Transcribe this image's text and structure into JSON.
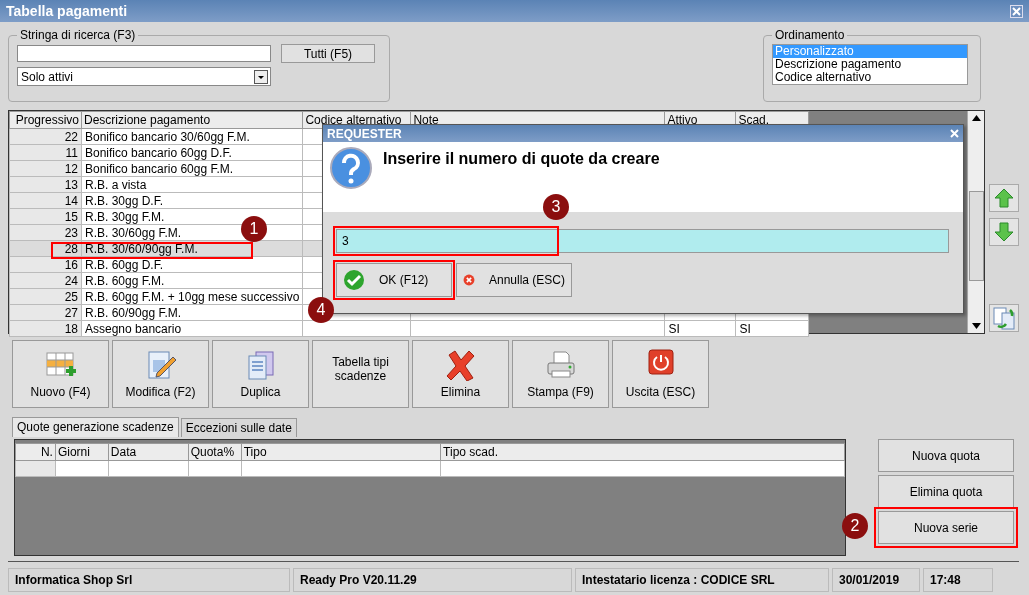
{
  "window": {
    "title": "Tabella pagamenti"
  },
  "search": {
    "legend": "Stringa di ricerca (F3)",
    "all_button": "Tutti (F5)",
    "filter": "Solo attivi"
  },
  "ordering": {
    "legend": "Ordinamento",
    "options": [
      {
        "label": "Personalizzato",
        "selected": true
      },
      {
        "label": "Descrizione pagamento",
        "selected": false
      },
      {
        "label": "Codice alternativo",
        "selected": false
      }
    ]
  },
  "table": {
    "columns": [
      "Progressivo",
      "Descrizione pagamento",
      "Codice alternativo",
      "Note",
      "Attivo",
      "Scad."
    ],
    "rows": [
      {
        "progressivo": "22",
        "descrizione": "Bonifico bancario 30/60gg F.M.",
        "selected": false
      },
      {
        "progressivo": "11",
        "descrizione": "Bonifico bancario 60gg D.F.",
        "selected": false
      },
      {
        "progressivo": "12",
        "descrizione": "Bonifico bancario 60gg F.M.",
        "selected": false
      },
      {
        "progressivo": "13",
        "descrizione": "R.B. a vista",
        "selected": false
      },
      {
        "progressivo": "14",
        "descrizione": "R.B. 30gg D.F.",
        "selected": false
      },
      {
        "progressivo": "15",
        "descrizione": "R.B. 30gg F.M.",
        "selected": false
      },
      {
        "progressivo": "23",
        "descrizione": "R.B. 30/60gg F.M.",
        "selected": false
      },
      {
        "progressivo": "28",
        "descrizione": "R.B. 30/60/90gg F.M.",
        "selected": true,
        "callout": "1"
      },
      {
        "progressivo": "16",
        "descrizione": "R.B. 60gg D.F.",
        "selected": false
      },
      {
        "progressivo": "24",
        "descrizione": "R.B. 60gg F.M.",
        "selected": false
      },
      {
        "progressivo": "25",
        "descrizione": "R.B. 60gg F.M. + 10gg mese successivo",
        "selected": false
      },
      {
        "progressivo": "27",
        "descrizione": "R.B. 60/90gg F.M.",
        "selected": false
      },
      {
        "progressivo": "18",
        "descrizione": "Assegno bancario",
        "attivo": "SI",
        "scad": "SI",
        "selected": false
      }
    ]
  },
  "toolbar": [
    {
      "label": "Nuovo (F4)",
      "kind": "grid"
    },
    {
      "label": "Modifica (F2)",
      "kind": "edit"
    },
    {
      "label": "Duplica",
      "kind": "copy"
    },
    {
      "label": "Tabella tipi scadenze",
      "kind": "text"
    },
    {
      "label": "Elimina",
      "kind": "delete"
    },
    {
      "label": "Stampa (F9)",
      "kind": "print"
    },
    {
      "label": "Uscita (ESC)",
      "kind": "exit"
    }
  ],
  "tabs": [
    {
      "label": "Quote generazione scadenze",
      "selected": true
    },
    {
      "label": "Eccezioni sulle date",
      "selected": false
    }
  ],
  "quote_table": {
    "columns": [
      "N.",
      "Giorni",
      "Data",
      "Quota%",
      "Tipo",
      "Tipo scad."
    ]
  },
  "quote_buttons": [
    {
      "label": "Nuova quota"
    },
    {
      "label": "Elimina quota"
    },
    {
      "label": "Nuova serie",
      "callout": "2"
    }
  ],
  "dialog": {
    "title": "REQUESTER",
    "message": "Inserire il numero di quote da creare",
    "value": "3",
    "value_callout": "3",
    "buttons": [
      {
        "label": "OK (F12)",
        "kind": "ok",
        "callout": "4"
      },
      {
        "label": "Annulla (ESC)",
        "kind": "cancel"
      }
    ]
  },
  "status_bar": [
    "Informatica Shop Srl",
    "Ready Pro V20.11.29",
    "Intestatario licenza : CODICE SRL",
    "30/01/2019",
    "17:48"
  ]
}
